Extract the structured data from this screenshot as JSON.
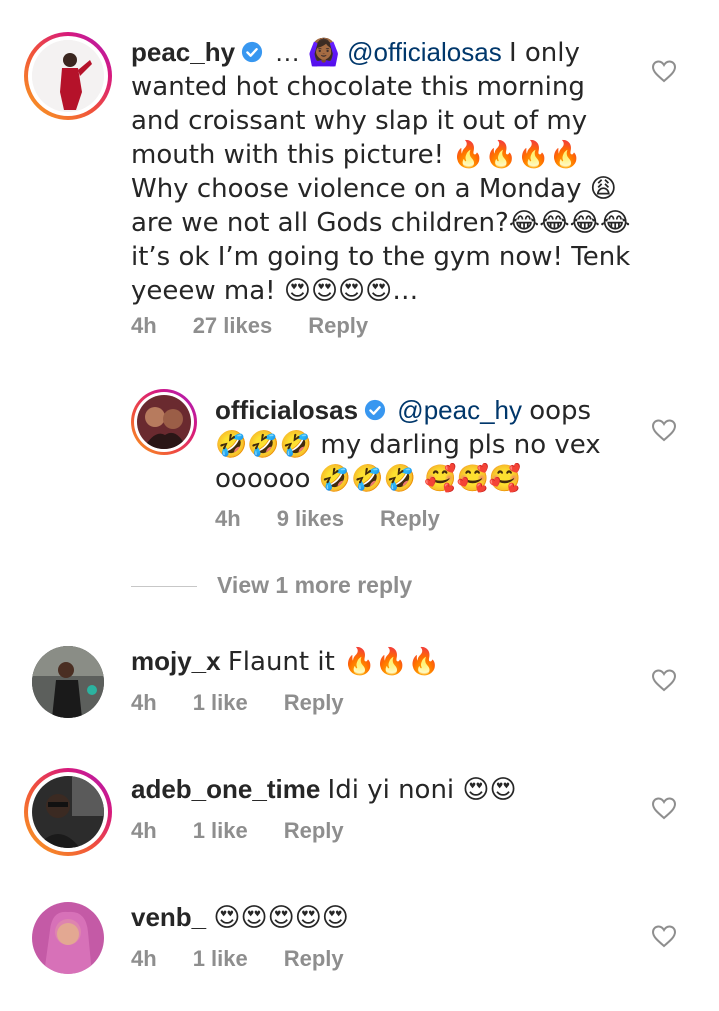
{
  "comments": [
    {
      "username": "peac_hy",
      "verified": true,
      "text_prefix": "…",
      "emoji_prefix": "🙆🏾‍♀️",
      "mention": "@officialosas",
      "text": "I only wanted hot chocolate this morning and croissant why slap it out of my mouth with this picture! 🔥🔥🔥🔥 Why choose violence on a Monday 😩 are we not all Gods children?😂😂😂😂 it’s ok I’m going to the gym now! Tenk yeeew ma! 😍😍😍😍…",
      "time": "4h",
      "likes": "27 likes",
      "reply": "Reply",
      "like_icon": "heart-outline-icon"
    },
    {
      "username": "officialosas",
      "verified": true,
      "mention": "@peac_hy",
      "text": "oops 🤣🤣🤣 my darling pls no vex oooooo 🤣🤣🤣 🥰🥰🥰",
      "time": "4h",
      "likes": "9 likes",
      "reply": "Reply",
      "like_icon": "heart-outline-icon"
    },
    {
      "username": "mojy_x",
      "text": "Flaunt it 🔥🔥🔥",
      "time": "4h",
      "likes": "1 like",
      "reply": "Reply",
      "like_icon": "heart-outline-icon"
    },
    {
      "username": "adeb_one_time",
      "text": "Idi yi noni 😍😍",
      "time": "4h",
      "likes": "1 like",
      "reply": "Reply",
      "like_icon": "heart-outline-icon"
    },
    {
      "username": "venb_",
      "text": "😍😍😍😍😍",
      "time": "4h",
      "likes": "1 like",
      "reply": "Reply",
      "like_icon": "heart-outline-icon"
    }
  ],
  "view_more_replies": "View 1 more reply",
  "colors": {
    "text": "#262626",
    "meta": "#8e8e8e",
    "mention": "#00376b",
    "verified": "#3897f0"
  }
}
